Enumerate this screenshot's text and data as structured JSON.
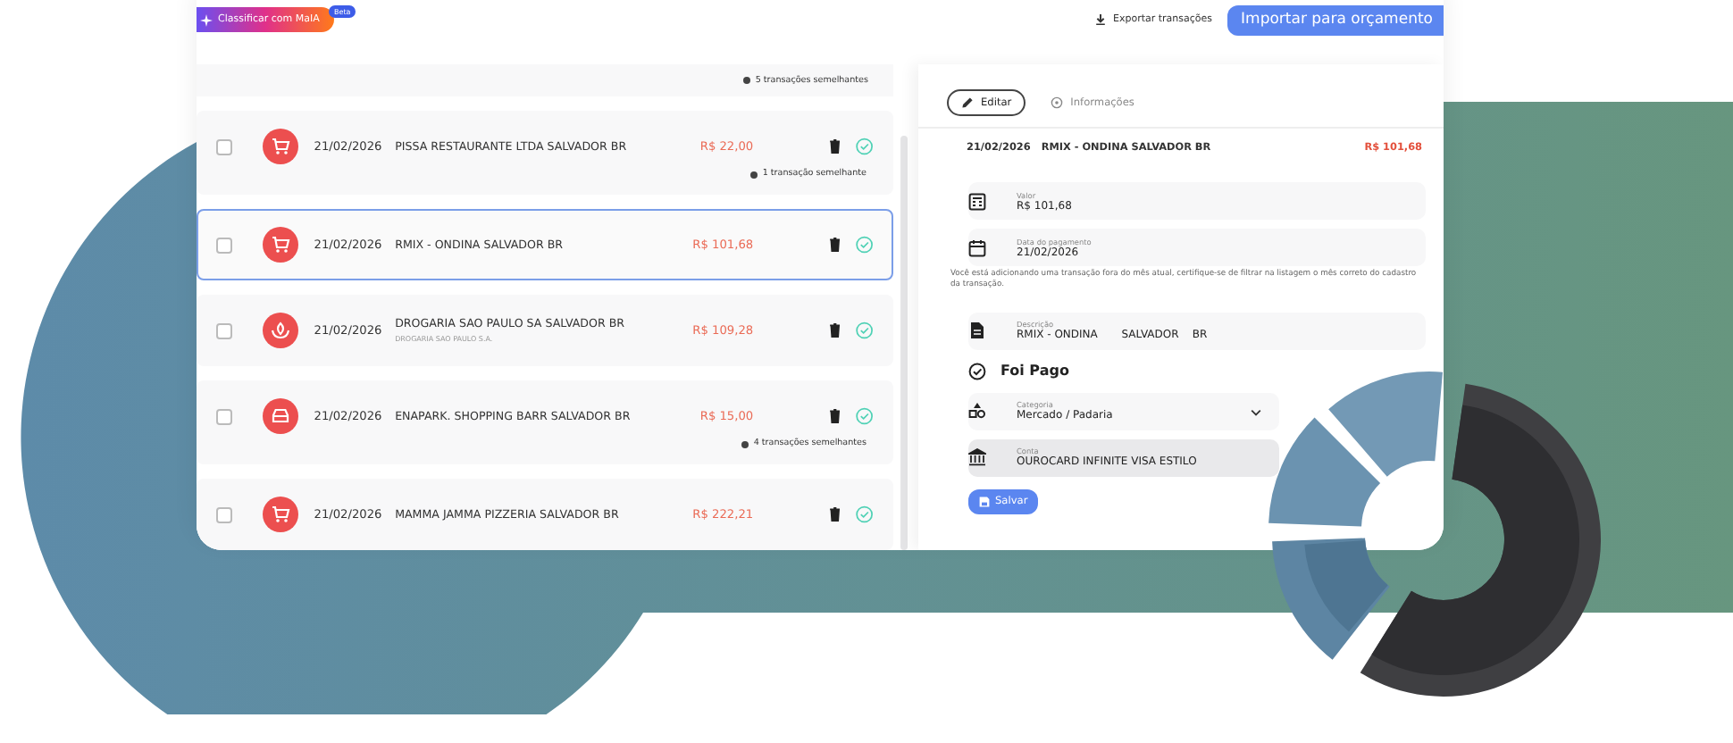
{
  "toolbar": {
    "classify_button": "Classificar com MaIA",
    "beta_badge": "Beta",
    "export_link": "Exportar transações",
    "import_button": "Importar para orçamento"
  },
  "list_top_similar": "5 transações semelhantes",
  "transactions": [
    {
      "kind": "market",
      "checked": false,
      "selected": false,
      "date": "21/02/2026",
      "description": "PISSA RESTAURANTE LTDA SALVADOR BR",
      "amount": "R$ 22,00",
      "similar": "1 transação semelhante"
    },
    {
      "kind": "market",
      "checked": false,
      "selected": true,
      "date": "21/02/2026",
      "description": "RMIX - ONDINA SALVADOR BR",
      "amount": "R$ 101,68"
    },
    {
      "kind": "pharmacy",
      "checked": false,
      "selected": false,
      "date": "21/02/2026",
      "description": "DROGARIA SAO PAULO SA SALVADOR BR",
      "subtitle": "DROGARIA SAO PAULO S.A.",
      "amount": "R$ 109,28"
    },
    {
      "kind": "transport",
      "checked": false,
      "selected": false,
      "date": "21/02/2026",
      "description": "ENAPARK. SHOPPING BARR SALVADOR BR",
      "amount": "R$ 15,00",
      "similar": "4 transações semelhantes"
    },
    {
      "kind": "market",
      "checked": false,
      "selected": false,
      "date": "21/02/2026",
      "description": "MAMMA JAMMA PIZZERIA SALVADOR BR",
      "amount": "R$ 222,21"
    }
  ],
  "detail": {
    "tabs": [
      {
        "label": "Editar",
        "selected": true
      },
      {
        "label": "Informações",
        "selected": false
      }
    ],
    "header": {
      "date": "21/02/2026",
      "description": "RMIX - ONDINA SALVADOR BR",
      "amount": "R$ 101,68"
    },
    "fields": [
      {
        "kind": "amount",
        "label": "Valor",
        "value": "R$ 101,68"
      },
      {
        "kind": "date",
        "label": "Data do pagamento",
        "value": "21/02/2026"
      },
      {
        "kind": "notice",
        "text": "Você está adicionando uma transação fora do mês atual, certifique-se de filtrar na listagem o mês correto do cadastro da transação."
      },
      {
        "kind": "description",
        "label": "Descrição",
        "value": "RMIX - ONDINA       SALVADOR    BR"
      },
      {
        "kind": "paid",
        "label": "Foi Pago"
      },
      {
        "kind": "category",
        "label": "Categoria",
        "value": "Mercado / Padaria"
      },
      {
        "kind": "account",
        "label": "Conta",
        "value": "OUROCARD INFINITE VISA ESTILO",
        "disabled": true
      }
    ],
    "save_button": "Salvar"
  }
}
